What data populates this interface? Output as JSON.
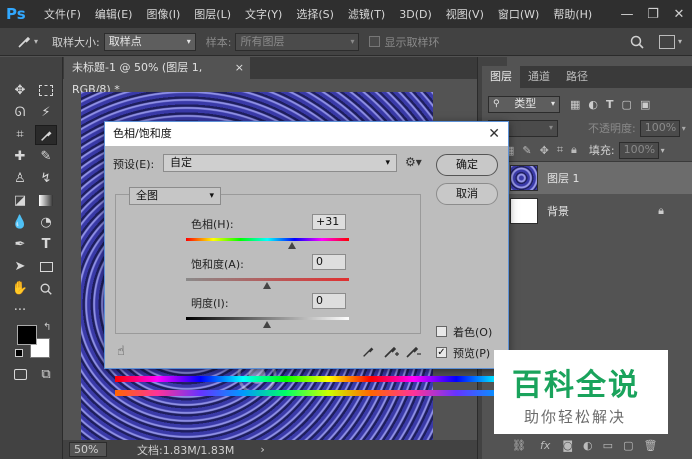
{
  "app": {
    "logo": "Ps"
  },
  "menu": [
    "文件(F)",
    "编辑(E)",
    "图像(I)",
    "图层(L)",
    "文字(Y)",
    "选择(S)",
    "滤镜(T)",
    "3D(D)",
    "视图(V)",
    "窗口(W)",
    "帮助(H)"
  ],
  "window_controls": {
    "minimize": "—",
    "restore": "❐",
    "close": "✕"
  },
  "options": {
    "sample_size_label": "取样大小:",
    "sample_size_value": "取样点",
    "sample_label": "样本:",
    "sample_value": "所有图层",
    "show_ring_label": "显示取样环"
  },
  "document": {
    "tab_title": "未标题-1 @ 50% (图层 1, RGB/8) *",
    "tab_close": "×",
    "zoom": "50%",
    "doc_info": "文档:1.83M/1.83M"
  },
  "layers_panel": {
    "tabs": [
      "图层",
      "通道",
      "路径"
    ],
    "filter_kind": "类型",
    "opacity_label": "不透明度:",
    "opacity_value": "100%",
    "fill_label": "填充:",
    "fill_value": "100%",
    "layers": [
      {
        "name": "图层 1"
      },
      {
        "name": "背景",
        "locked": true
      }
    ]
  },
  "dialog": {
    "title": "色相/饱和度",
    "close": "✕",
    "preset_label": "预设(E):",
    "preset_value": "自定",
    "ok_label": "确定",
    "cancel_label": "取消",
    "channel_value": "全图",
    "hue_label": "色相(H):",
    "hue_value": "+31",
    "saturation_label": "饱和度(A):",
    "saturation_value": "0",
    "lightness_label": "明度(I):",
    "lightness_value": "0",
    "colorize_label": "着色(O)",
    "colorize_checked": false,
    "preview_label": "预览(P)",
    "preview_checked": true
  },
  "watermark": {
    "title": "百科全说",
    "subtitle": "助你轻松解决"
  },
  "colors": {
    "menubar": "#2f2f2f",
    "panel": "#535353",
    "accent": "#31a8ff",
    "watermark_green": "#1aa35c"
  }
}
